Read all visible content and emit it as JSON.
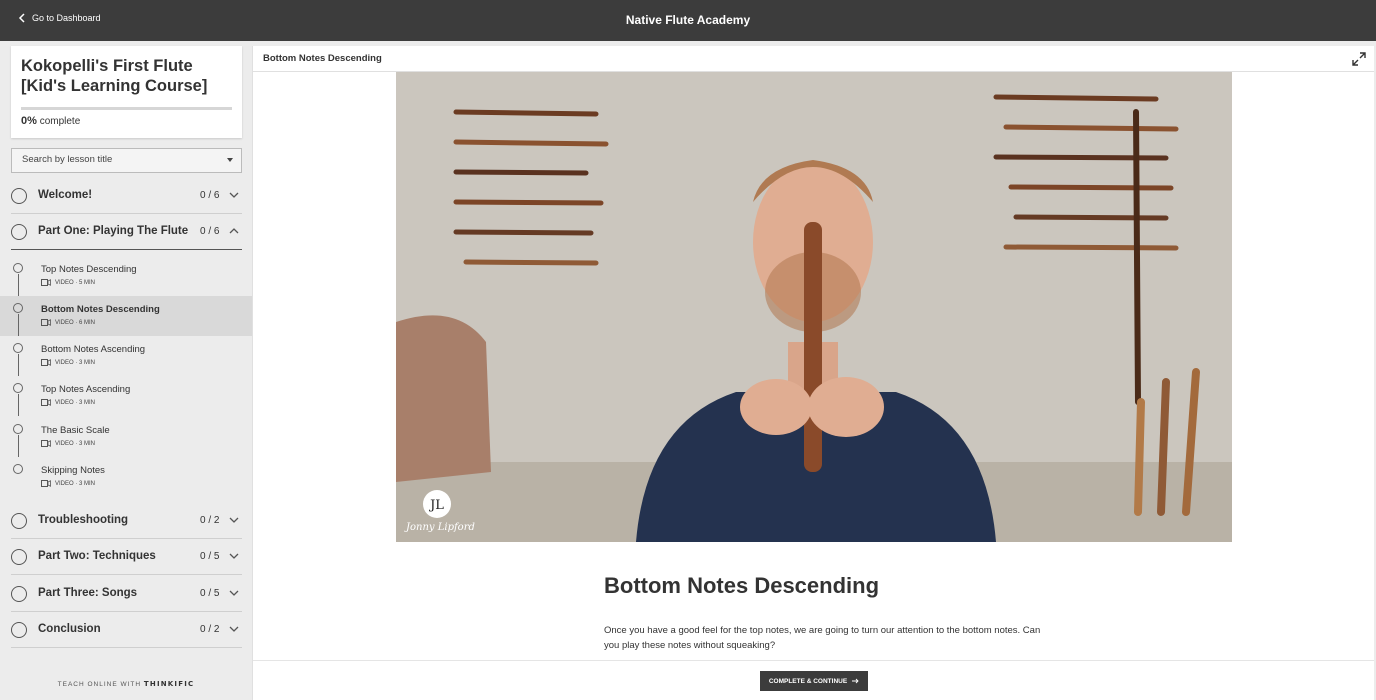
{
  "topbar": {
    "back_label": "Go to Dashboard",
    "site_title": "Native Flute Academy"
  },
  "course": {
    "title": "Kokopelli's First Flute [Kid's Learning Course]",
    "progress_value": "0%",
    "progress_suffix": "complete",
    "progress_fraction": 0
  },
  "search": {
    "placeholder": "Search by lesson title"
  },
  "chapters": [
    {
      "title": "Welcome!",
      "count": "0 / 6",
      "expanded": false
    },
    {
      "title": "Part One: Playing The Flute",
      "count": "0 / 6",
      "expanded": true
    },
    {
      "title": "Troubleshooting",
      "count": "0 / 2",
      "expanded": false
    },
    {
      "title": "Part Two: Techniques",
      "count": "0 / 5",
      "expanded": false
    },
    {
      "title": "Part Three: Songs",
      "count": "0 / 5",
      "expanded": false
    },
    {
      "title": "Conclusion",
      "count": "0 / 2",
      "expanded": false
    }
  ],
  "lessons": [
    {
      "title": "Top Notes Descending",
      "meta": "VIDEO · 5 MIN",
      "active": false
    },
    {
      "title": "Bottom Notes Descending",
      "meta": "VIDEO · 6 MIN",
      "active": true
    },
    {
      "title": "Bottom Notes Ascending",
      "meta": "VIDEO · 3 MIN",
      "active": false
    },
    {
      "title": "Top Notes Ascending",
      "meta": "VIDEO · 3 MIN",
      "active": false
    },
    {
      "title": "The Basic Scale",
      "meta": "VIDEO · 3 MIN",
      "active": false
    },
    {
      "title": "Skipping Notes",
      "meta": "VIDEO · 3 MIN",
      "active": false
    }
  ],
  "footer_brand": {
    "prefix": "TEACH ONLINE WITH",
    "brand": "THINKIFIC"
  },
  "main": {
    "crumb": "Bottom Notes Descending",
    "heading": "Bottom Notes Descending",
    "body": "Once you have a good feel for the top notes, we are going to turn our attention to the bottom notes. Can you play these notes without squeaking?",
    "video_watermark": "Jonny Lipford",
    "video_logo": "JL",
    "cta_label": "COMPLETE & CONTINUE"
  },
  "colors": {
    "topbar": "#3c3c3c",
    "sidebar": "#ececec",
    "active_lesson": "#d9d9d9",
    "video_shirt": "#24324f"
  },
  "icons": {
    "back": "chevron-left-icon",
    "expand": "expand-icon",
    "lesson_type": "video-icon",
    "cta": "arrow-right-icon"
  }
}
